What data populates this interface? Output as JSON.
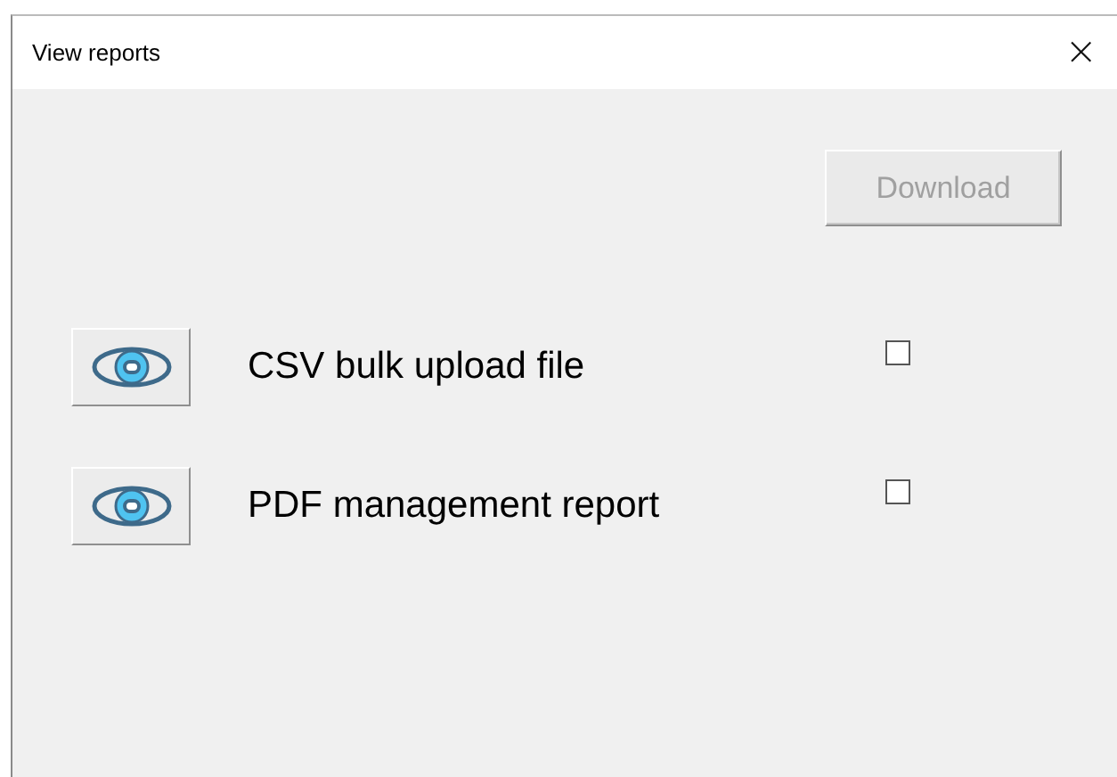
{
  "window": {
    "title": "View reports",
    "close": "×"
  },
  "download_button": {
    "label": "Download",
    "disabled": true
  },
  "reports": [
    {
      "name": "CSV bulk upload file",
      "checked": false
    },
    {
      "name": "PDF management report",
      "checked": false
    }
  ]
}
